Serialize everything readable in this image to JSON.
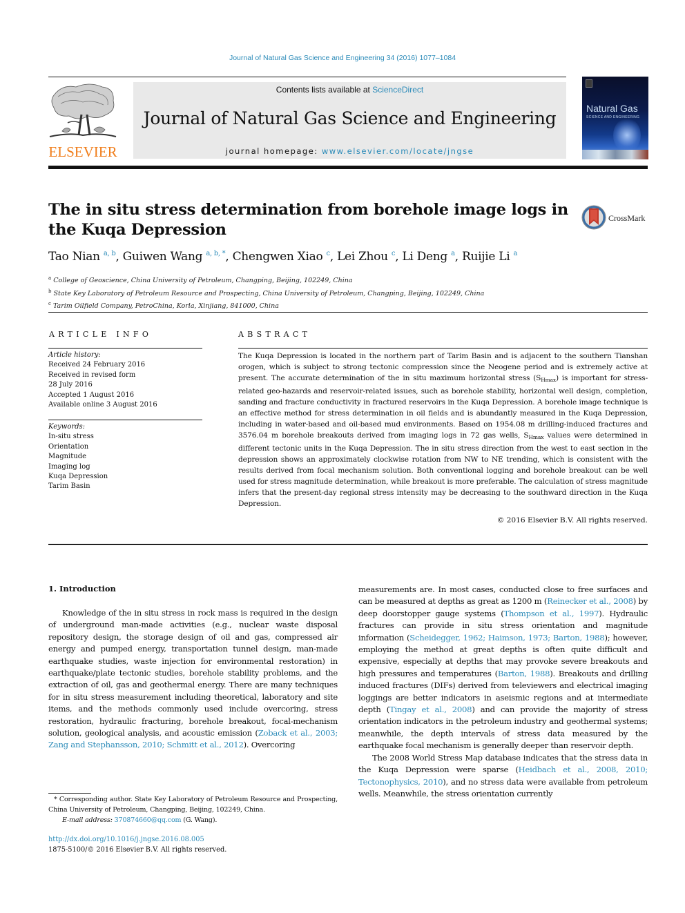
{
  "header": {
    "citation": "Journal of Natural Gas Science and Engineering 34 (2016) 1077–1084",
    "contents_prefix": "Contents lists available at ",
    "contents_link": "ScienceDirect",
    "journal_title": "Journal of Natural Gas Science and Engineering",
    "homepage_prefix": "journal homepage: ",
    "homepage_link": "www.elsevier.com/locate/jngse",
    "publisher_logo_text": "ELSEVIER",
    "cover": {
      "title": "Natural Gas",
      "subtitle": "SCIENCE AND ENGINEERING"
    }
  },
  "article": {
    "title": "The in situ stress determination from borehole image logs in the Kuqa Depression",
    "crossmark_label": "CrossMark",
    "authors": [
      {
        "name": "Tao Nian",
        "sup": "a, b",
        "sep": ", "
      },
      {
        "name": "Guiwen Wang",
        "sup": "a, b, *",
        "sep": ", "
      },
      {
        "name": "Chengwen Xiao",
        "sup": "c",
        "sep": ", "
      },
      {
        "name": "Lei Zhou",
        "sup": "c",
        "sep": ", "
      },
      {
        "name": "Li Deng",
        "sup": "a",
        "sep": ", "
      },
      {
        "name": "Ruijie Li",
        "sup": "a",
        "sep": ""
      }
    ],
    "affiliations": [
      {
        "mark": "a",
        "text": "College of Geoscience, China University of Petroleum, Changping, Beijing, 102249, China"
      },
      {
        "mark": "b",
        "text": "State Key Laboratory of Petroleum Resource and Prospecting, China University of Petroleum, Changping, Beijing, 102249, China"
      },
      {
        "mark": "c",
        "text": "Tarim Oilfield Company, PetroChina, Korla, Xinjiang, 841000, China"
      }
    ]
  },
  "article_info": {
    "heading": "ARTICLE INFO",
    "history_label": "Article history:",
    "history": [
      "Received 24 February 2016",
      "Received in revised form",
      "28 July 2016",
      "Accepted 1 August 2016",
      "Available online 3 August 2016"
    ],
    "keywords_label": "Keywords:",
    "keywords": [
      "In-situ stress",
      "Orientation",
      "Magnitude",
      "Imaging log",
      "Kuqa Depression",
      "Tarim Basin"
    ]
  },
  "abstract": {
    "heading": "ABSTRACT",
    "part1": "The Kuqa Depression is located in the northern part of Tarim Basin and is adjacent to the southern Tianshan orogen, which is subject to strong tectonic compression since the Neogene period and is extremely active at present. The accurate determination of the in situ maximum horizontal stress (S",
    "sub1": "Hmax",
    "part2": ") is important for stress-related geo-hazards and reservoir-related issues, such as borehole stability, horizontal well design, completion, sanding and fracture conductivity in fractured reservoirs in the Kuqa Depression. A borehole image technique is an effective method for stress determination in oil fields and is abundantly measured in the Kuqa Depression, including in water-based and oil-based mud environments. Based on 1954.08 m drilling-induced fractures and 3576.04 m borehole breakouts derived from imaging logs in 72 gas wells, S",
    "sub2": "Hmax",
    "part3": " values were determined in different tectonic units in the Kuqa Depression. The in situ stress direction from the west to east section in the depression shows an approximately clockwise rotation from NW to NE trending, which is consistent with the results derived from focal mechanism solution. Both conventional logging and borehole breakout can be well used for stress magnitude determination, while breakout is more preferable. The calculation of stress magnitude infers that the present-day regional stress intensity may be decreasing to the southward direction in the Kuqa Depression.",
    "copyright": "© 2016 Elsevier B.V. All rights reserved."
  },
  "introduction": {
    "heading": "1.  Introduction",
    "left_p1_text": "Knowledge of the in situ stress in rock mass is required in the design of underground man-made activities (e.g., nuclear waste disposal repository design, the storage design of oil and gas, compressed air energy and pumped energy, transportation tunnel design, man-made earthquake studies, waste injection for environmental restoration) in earthquake/plate tectonic studies, borehole stability problems, and the extraction of oil, gas and geothermal energy. There are many techniques for in situ stress measurement including theoretical, laboratory and site items, and the methods commonly used include overcoring, stress restoration, hydraulic fracturing, borehole breakout, focal-mechanism solution, geological analysis, and acoustic emission (",
    "left_p1_cite": "Zoback et al., 2003; Zang and Stephansson, 2010; Schmitt et al., 2012",
    "left_p1_tail": "). Overcoring",
    "right_p1": {
      "t1": "measurements are. In most cases, conducted close to free surfaces and can be measured at depths as great as 1200 m (",
      "c1": "Reinecker et al., 2008",
      "t2": ") by deep doorstopper gauge systems (",
      "c2": "Thompson et al., 1997",
      "t3": "). Hydraulic fractures can provide in situ stress orientation and magnitude information (",
      "c3": "Scheidegger, 1962; Haimson, 1973; Barton, 1988",
      "t4": "); however, employing the method at great depths is often quite difficult and expensive, especially at depths that may provoke severe breakouts and high pressures and temperatures (",
      "c4": "Barton, 1988",
      "t5": "). Breakouts and drilling induced fractures (DIFs) derived from televiewers and electrical imaging loggings are better indicators in aseismic regions and at intermediate depth (",
      "c5": "Tingay et al., 2008",
      "t6": ") and can provide the majority of stress orientation indicators in the petroleum industry and geothermal systems; meanwhile, the depth intervals of stress data measured by the earthquake focal mechanism is generally deeper than reservoir depth."
    },
    "right_p2": {
      "t1": "The 2008 World Stress Map database indicates that the stress data in the Kuqa Depression were sparse (",
      "c1": "Heidbach et al., 2008, 2010; Tectonophysics, 2010",
      "t2": "), and no stress data were available from petroleum wells. Meanwhile, the stress orientation currently"
    }
  },
  "footnote": {
    "corresponding": "* Corresponding author. State Key Laboratory of Petroleum Resource and Prospecting, China University of Petroleum, Changping, Beijing, 102249, China.",
    "email_label": "E-mail address: ",
    "email": "370874660@qq.com",
    "email_suffix": " (G. Wang).",
    "doi": "http://dx.doi.org/10.1016/j.jngse.2016.08.005",
    "issn": "1875-5100/© 2016 Elsevier B.V. All rights reserved."
  },
  "colors": {
    "link": "#2a8ab8",
    "elsevier_orange": "#f07d1a",
    "masthead_gray": "#e9e9e9"
  }
}
